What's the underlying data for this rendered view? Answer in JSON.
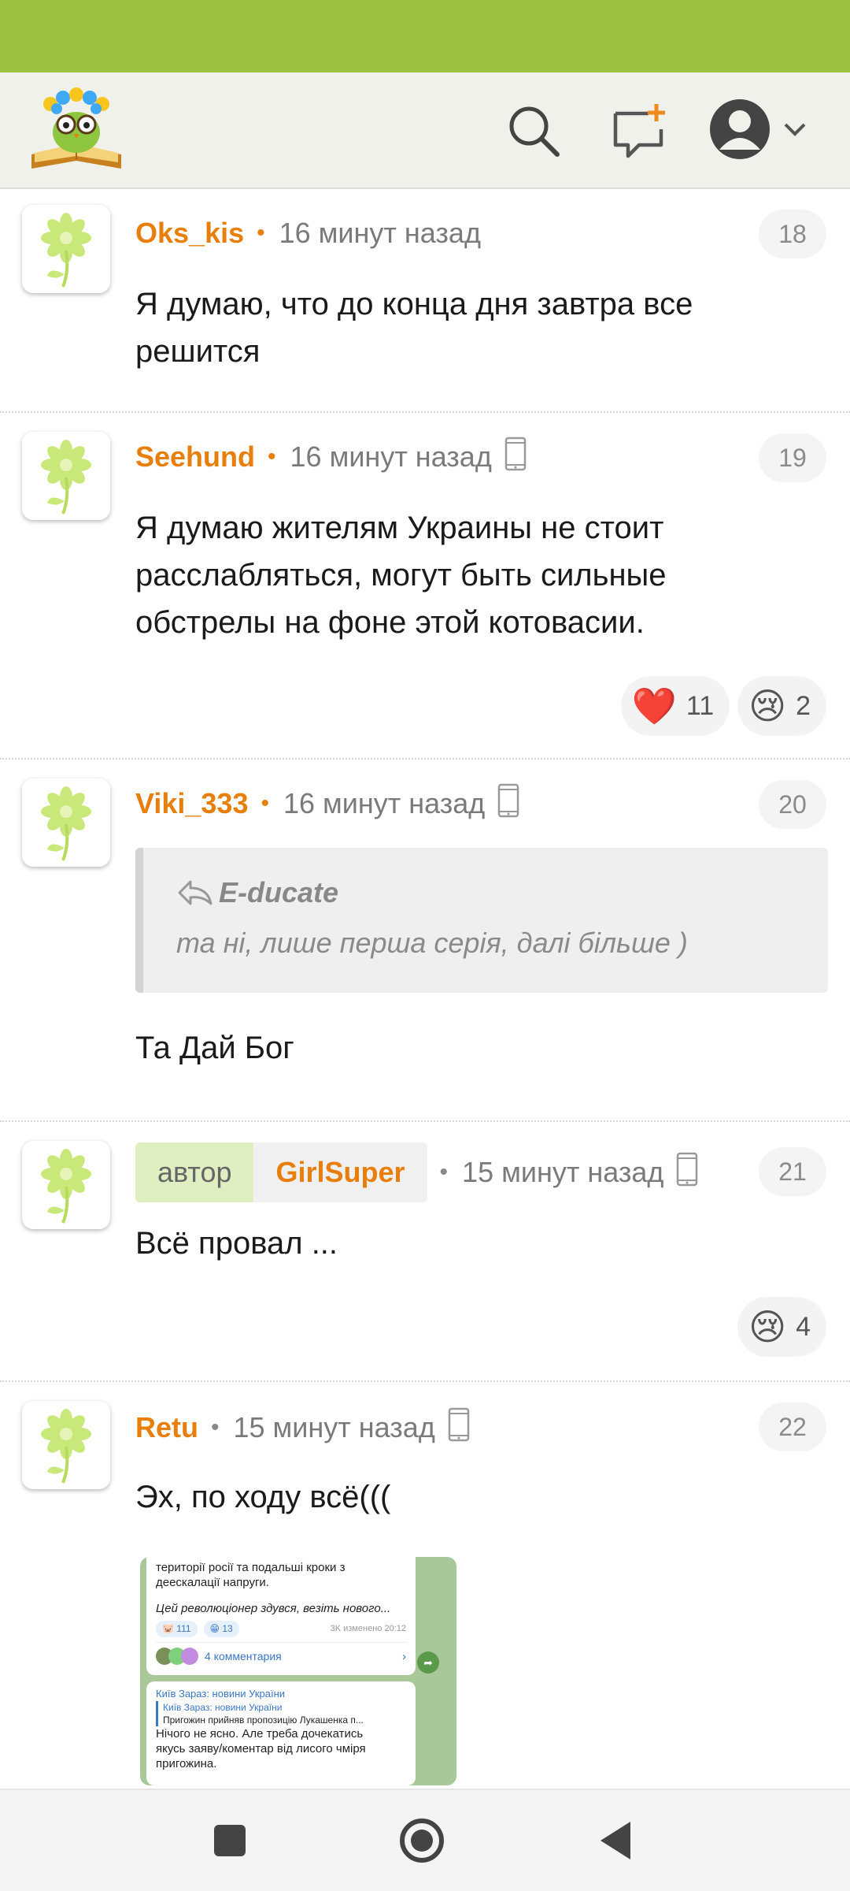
{
  "header": {
    "logo_icon": "owl-reading-book-logo",
    "search_icon": "search-icon",
    "new_post_icon": "new-message-icon",
    "account_icon": "user-avatar-icon"
  },
  "comments": [
    {
      "username": "Oks_kis",
      "time": "16 минут назад",
      "number": "18",
      "text": "Я думаю, что до конца дня завтра все решится"
    },
    {
      "username": "Seehund",
      "time": "16 минут назад",
      "number": "19",
      "text": "Я думаю жителям Украины не стоит расслабляться, могут быть сильные обстрелы на фоне этой котовасии.",
      "reactions": [
        {
          "emoji": "❤️",
          "count": "11"
        },
        {
          "emoji": "😢",
          "count": "2"
        }
      ]
    },
    {
      "username": "Viki_333",
      "time": "16 минут назад",
      "number": "20",
      "quote": {
        "author": "E-ducate",
        "text": "та ні, лише перша серія, далі більше )"
      },
      "text": "Та Дай Бог"
    },
    {
      "author_label": "автор",
      "username": "GirlSuper",
      "time": "15 минут назад",
      "number": "21",
      "text": "Всё провал ...",
      "reactions": [
        {
          "emoji": "😢",
          "count": "4"
        }
      ]
    },
    {
      "username": "Retu",
      "time": "15 минут назад",
      "number": "22",
      "text": "Эх, по ходу всё(((",
      "attachment": {
        "line1": "території росії та подальші кроки з",
        "line2": "деескалації напруги.",
        "line3": "Цей революціонер здувся, везіть нового...",
        "react1": "111",
        "react2": "13",
        "views": "3K изменено 20:12",
        "comments": "4 комментария",
        "channel": "Київ Зараз: новини України",
        "channel2": "Київ Зараз: новини України",
        "forward": "Пригожин прийняв пропозицію Лукашенка п...",
        "body1": "Нічого не ясно. Але треба дочекатись",
        "body2": "якусь заяву/коментар від лисого чміря",
        "body3": "пригожина."
      }
    }
  ],
  "colors": {
    "status_bar": "#9dc242",
    "username": "#e87f0c",
    "author_label_bg": "#e0efc2"
  },
  "navigation": {
    "recents_icon": "square-icon",
    "home_icon": "circle-home-icon",
    "back_icon": "triangle-back-icon"
  }
}
